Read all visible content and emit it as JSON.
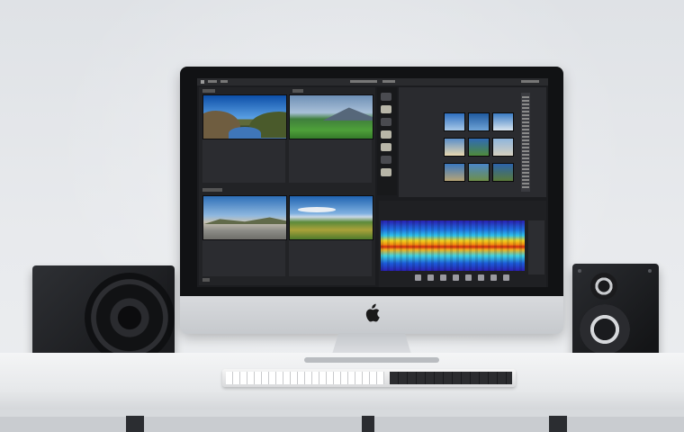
{
  "scene": {
    "description_icons": [
      "apple-logo-icon"
    ],
    "colors": {
      "wall": "#e3e6e9",
      "desk": "#eef0f2",
      "monitor_bezel": "#111214",
      "monitor_chin": "#cfd2d5",
      "screen_background": "#1b1c1f"
    }
  }
}
